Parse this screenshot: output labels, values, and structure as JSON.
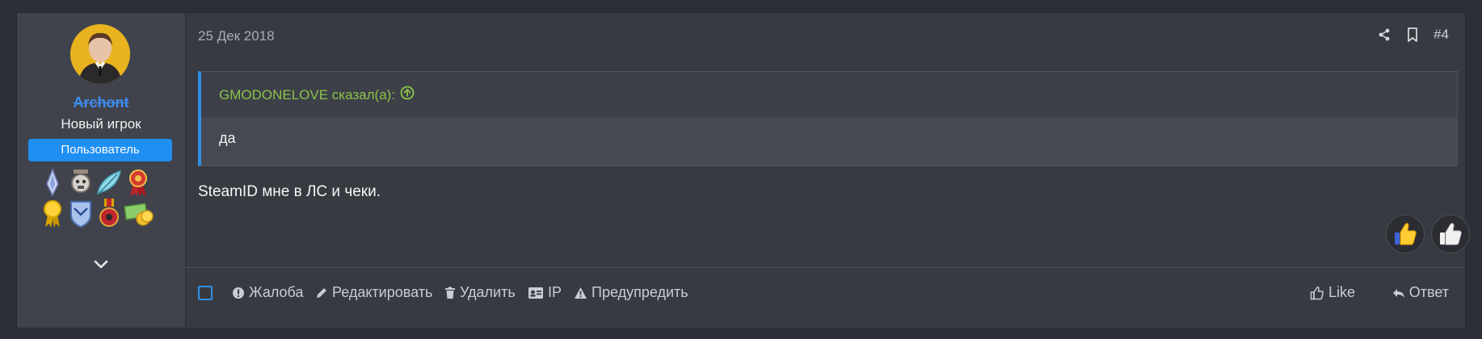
{
  "post": {
    "date": "25 Дек 2018",
    "number": "#4",
    "user": {
      "name": "Archont",
      "title": "Новый игрок",
      "banner": "Пользователь"
    },
    "quote": {
      "author_line": "GMODONELOVE сказал(а):",
      "text": "да"
    },
    "message": "SteamID мне в ЛС и чеки."
  },
  "footer": {
    "report": "Жалоба",
    "edit": "Редактировать",
    "delete": "Удалить",
    "ip": "IP",
    "warn": "Предупредить",
    "like": "Like",
    "reply": "Ответ"
  },
  "colors": {
    "accent": "#1f8ff2",
    "quote_author": "#8bc34a",
    "username": "#3d8cf0"
  }
}
